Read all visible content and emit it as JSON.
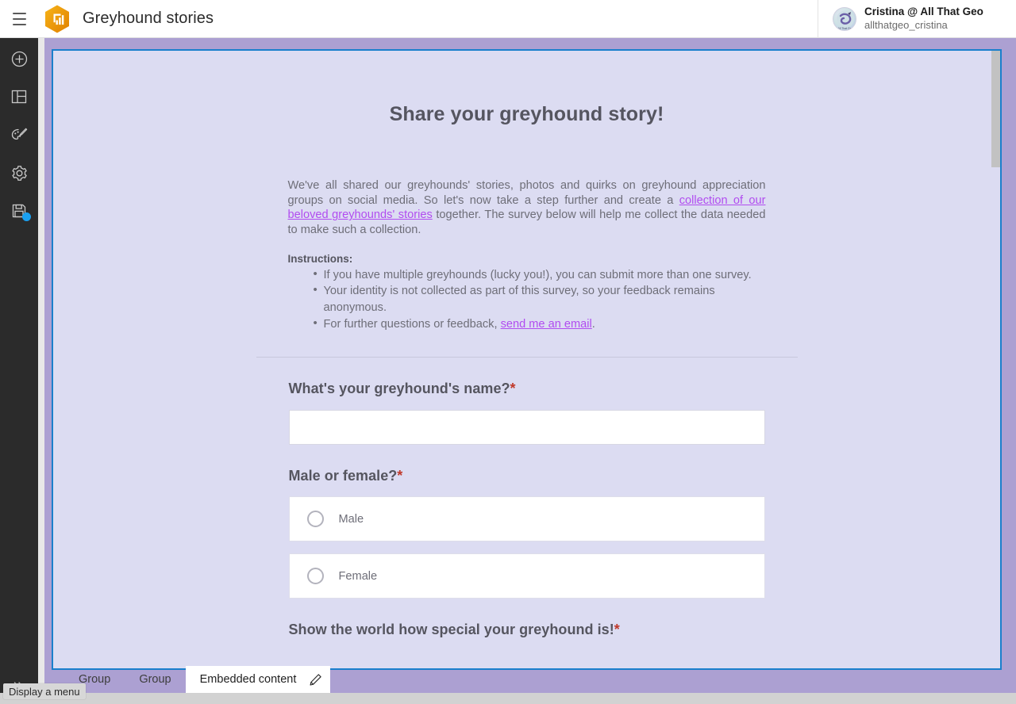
{
  "header": {
    "menu_icon": "hamburger-icon",
    "logo_icon": "experience-builder-logo",
    "title": "Greyhound stories",
    "user": {
      "avatar_icon": "user-avatar",
      "name": "Cristina @ All That Geo",
      "handle": "allthatgeo_cristina"
    }
  },
  "sidebar": {
    "items": [
      {
        "icon": "plus-circle-icon",
        "name": "add-widget"
      },
      {
        "icon": "page-layout-icon",
        "name": "page-layout"
      },
      {
        "icon": "palette-brush-icon",
        "name": "theme"
      },
      {
        "icon": "gear-icon",
        "name": "settings"
      },
      {
        "icon": "save-floppy-icon",
        "name": "save",
        "badge": "unsaved-changes"
      }
    ],
    "expand_icon": "double-chevron-icon"
  },
  "form": {
    "title": "Share your greyhound story!",
    "intro": {
      "part1": "We've all shared our greyhounds' stories, photos and quirks on greyhound appreciation groups on social media. So let's now take a step further and create a ",
      "link1": "collection of our beloved greyhounds'  stories",
      "part2": " together. The survey below will help me collect the data needed to make such a collection."
    },
    "instructions_label": "Instructions:",
    "bullets": [
      {
        "text": "If you have multiple greyhounds (lucky you!), you can submit more than one survey."
      },
      {
        "text": "Your identity is not collected as part of this survey, so your feedback remains anonymous."
      },
      {
        "pre": "For further questions or feedback, ",
        "link": "send me an email",
        "post": "."
      }
    ],
    "questions": [
      {
        "label": "What's your greyhound's name?",
        "required": "*",
        "type": "text",
        "value": "",
        "placeholder": ""
      },
      {
        "label": "Male or female?",
        "required": "*",
        "type": "radio",
        "options": [
          {
            "label": "Male",
            "selected": false
          },
          {
            "label": "Female",
            "selected": false
          }
        ]
      },
      {
        "label": "Show the world how special your greyhound is!",
        "required": "*",
        "type": "text-partial"
      }
    ]
  },
  "tabs": [
    {
      "label": "Group",
      "active": false
    },
    {
      "label": "Group",
      "active": false
    },
    {
      "label": "Embedded content",
      "active": true,
      "edit_icon": "pencil-icon"
    }
  ],
  "tooltip": {
    "text": "Display a menu"
  },
  "colors": {
    "accent_orange": "#f0a000",
    "selection_blue": "#1a7fcc",
    "page_purple": "#aca0d2",
    "form_bg": "#dcdcf2",
    "required_red": "#c0392b",
    "link_purple": "#b14cf0",
    "badge_blue": "#1aa0f0"
  }
}
